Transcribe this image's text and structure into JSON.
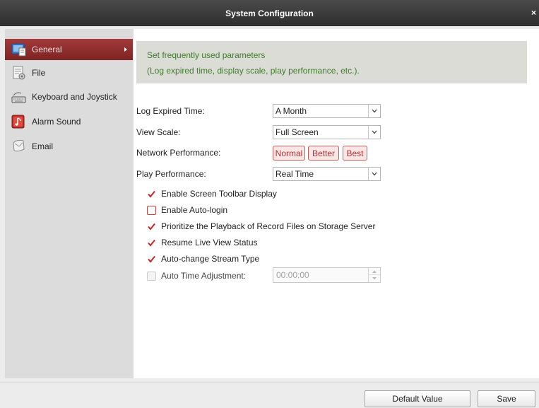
{
  "window": {
    "title": "System Configuration",
    "close_glyph": "×"
  },
  "sidebar": {
    "items": [
      {
        "label": "General",
        "icon": "general-settings-icon",
        "active": true
      },
      {
        "label": "File",
        "icon": "file-icon",
        "active": false
      },
      {
        "label": "Keyboard and Joystick",
        "icon": "keyboard-icon",
        "active": false
      },
      {
        "label": "Alarm Sound",
        "icon": "alarm-sound-icon",
        "active": false
      },
      {
        "label": "Email",
        "icon": "email-icon",
        "active": false
      }
    ]
  },
  "tip": {
    "line1": "Set frequently used parameters",
    "line2": "(Log expired time, display scale, play performance, etc.)."
  },
  "form": {
    "log_expired": {
      "label": "Log Expired Time:",
      "value": "A Month"
    },
    "view_scale": {
      "label": "View Scale:",
      "value": "Full Screen"
    },
    "network_performance": {
      "label": "Network Performance:",
      "options": [
        "Normal",
        "Better",
        "Best"
      ]
    },
    "play_performance": {
      "label": "Play Performance:",
      "value": "Real Time"
    },
    "checkboxes": [
      {
        "label": "Enable Screen Toolbar Display",
        "checked": true
      },
      {
        "label": "Enable Auto-login",
        "checked": false
      },
      {
        "label": "Prioritize the Playback of Record Files on Storage Server",
        "checked": true
      },
      {
        "label": "Resume Live View Status",
        "checked": true
      },
      {
        "label": "Auto-change Stream Type",
        "checked": true
      }
    ],
    "auto_time": {
      "label": "Auto Time Adjustment:",
      "checked": false,
      "enabled": false,
      "value": "00:00:00"
    }
  },
  "footer": {
    "default_label": "Default Value",
    "save_label": "Save"
  },
  "colors": {
    "accent": "#8f2b2b",
    "tip_text": "#3e7d2a",
    "check_red": "#c62828"
  }
}
